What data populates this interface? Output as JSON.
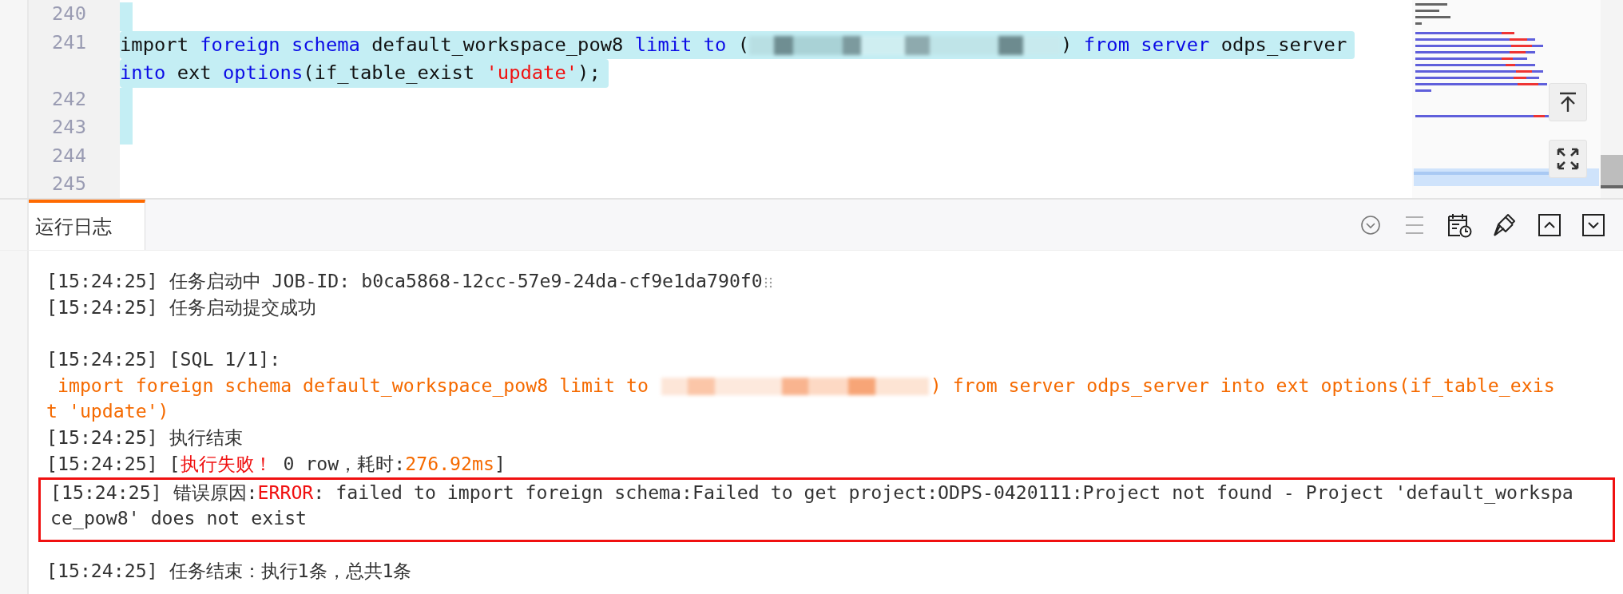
{
  "editor": {
    "lines": [
      {
        "number": "240",
        "selected": true
      },
      {
        "number": "241",
        "selected": true,
        "tokens": [
          {
            "text": "import ",
            "kind": "plain"
          },
          {
            "text": "foreign ",
            "kind": "keyword"
          },
          {
            "text": "schema ",
            "kind": "keyword"
          },
          {
            "text": "default_workspace_pow8 ",
            "kind": "plain"
          },
          {
            "text": "limit ",
            "kind": "keyword"
          },
          {
            "text": "to ",
            "kind": "keyword"
          },
          {
            "text": "(",
            "kind": "plain"
          },
          {
            "kind": "redacted"
          },
          {
            "text": ") ",
            "kind": "plain"
          },
          {
            "text": "from ",
            "kind": "keyword"
          },
          {
            "text": "server ",
            "kind": "keyword"
          },
          {
            "text": "odps_server",
            "kind": "plain"
          }
        ]
      },
      {
        "selected": true,
        "tokens": [
          {
            "text": "into ",
            "kind": "keyword"
          },
          {
            "text": "ext ",
            "kind": "plain"
          },
          {
            "text": "options",
            "kind": "keyword"
          },
          {
            "text": "(if_table_exist ",
            "kind": "plain"
          },
          {
            "text": "'update'",
            "kind": "string"
          },
          {
            "text": ");",
            "kind": "plain"
          }
        ]
      },
      {
        "number": "242",
        "selected": true
      },
      {
        "number": "243",
        "selected": true
      },
      {
        "number": "244",
        "selected": false
      },
      {
        "number": "245",
        "selected": false
      }
    ]
  },
  "panel": {
    "tabs": [
      {
        "label": "运行日志",
        "selected": true
      }
    ],
    "log": [
      {
        "copyable": true,
        "rows": [
          {
            "segments": [
              {
                "text": "[15:24:25] 任务启动中 JOB-ID: b0ca5868-12cc-57e9-24da-cf9e1da790f0",
                "kind": "normal"
              }
            ]
          }
        ]
      },
      {
        "rows": [
          {
            "segments": [
              {
                "text": "[15:24:25] 任务启动提交成功",
                "kind": "normal"
              }
            ]
          }
        ]
      },
      {
        "spaced": true,
        "rows": [
          {
            "segments": [
              {
                "text": "[15:24:25] [SQL 1/1]:",
                "kind": "normal"
              }
            ]
          }
        ]
      },
      {
        "rows": [
          {
            "segments": [
              {
                "text": " import foreign schema default_workspace_pow8 limit to ",
                "kind": "accent"
              },
              {
                "kind": "redacted"
              },
              {
                "text": ") from server odps_server into ext options(if_table_exis",
                "kind": "accent"
              }
            ]
          },
          {
            "segments": [
              {
                "text": "t 'update')",
                "kind": "accent"
              }
            ]
          }
        ]
      },
      {
        "rows": [
          {
            "segments": [
              {
                "text": "[15:24:25] 执行结束",
                "kind": "normal"
              }
            ]
          }
        ]
      },
      {
        "rows": [
          {
            "segments": [
              {
                "text": "[15:24:25] [",
                "kind": "normal"
              },
              {
                "text": "执行失败！",
                "kind": "alert"
              },
              {
                "text": " 0 row，耗时:",
                "kind": "normal"
              },
              {
                "text": "276.92ms",
                "kind": "accent"
              },
              {
                "text": "]",
                "kind": "normal"
              }
            ]
          }
        ]
      },
      {
        "highlighted": true,
        "rows": [
          {
            "segments": [
              {
                "text": "[15:24:25] 错误原因:",
                "kind": "normal"
              },
              {
                "text": "ERROR",
                "kind": "alert"
              },
              {
                "text": ": failed to import foreign schema:Failed to get project:ODPS-0420111:Project not found - Project 'default_workspa",
                "kind": "normal"
              }
            ]
          },
          {
            "segments": [
              {
                "text": "ce_pow8' does not exist",
                "kind": "normal"
              }
            ]
          }
        ]
      },
      {
        "spaced": true,
        "rows": [
          {
            "segments": [
              {
                "text": "[15:24:25] 任务结束：执行1条，总共1条",
                "kind": "normal"
              }
            ]
          }
        ]
      }
    ]
  }
}
